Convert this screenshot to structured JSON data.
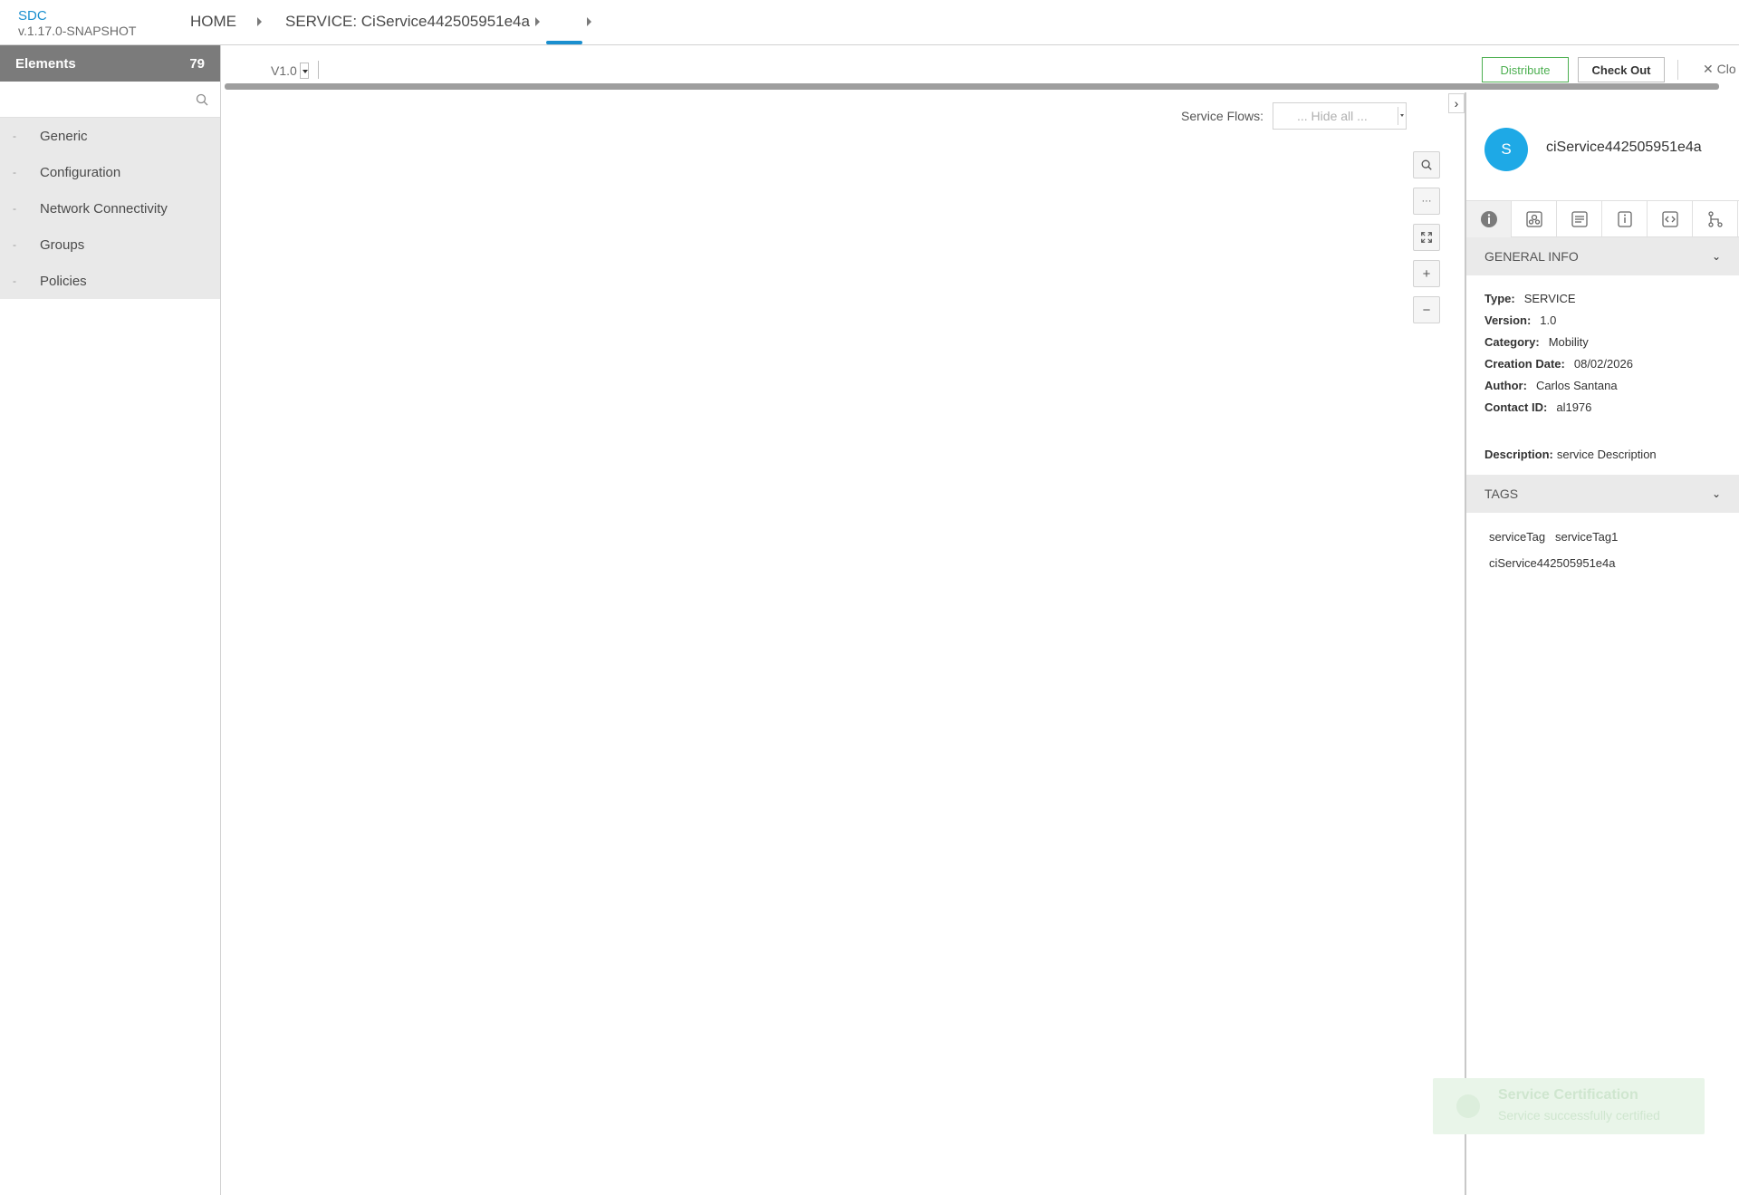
{
  "header": {
    "brand": "SDC",
    "version": "v.1.17.0-SNAPSHOT",
    "crumbs": [
      "HOME",
      "SERVICE: CiService442505951e4a",
      ""
    ]
  },
  "left_panel": {
    "title": "Elements",
    "count": "79",
    "search_placeholder": "",
    "items": [
      {
        "label": "Generic"
      },
      {
        "label": "Configuration"
      },
      {
        "label": "Network Connectivity"
      },
      {
        "label": "Groups"
      },
      {
        "label": "Policies"
      }
    ]
  },
  "toolbar": {
    "version": "V1.0",
    "distribute_label": "Distribute",
    "checkout_label": "Check Out",
    "close_label": "Clo"
  },
  "canvas": {
    "service_flows_label": "Service Flows:",
    "service_flows_value": "... Hide all ..."
  },
  "right_panel": {
    "avatar_letter": "S",
    "title": "ciService442505951e4a",
    "general_info_title": "GENERAL INFO",
    "fields": [
      {
        "label": "Type:",
        "value": "SERVICE"
      },
      {
        "label": "Version:",
        "value": "1.0"
      },
      {
        "label": "Category:",
        "value": "Mobility"
      },
      {
        "label": "Creation Date:",
        "value": "08/02/2026"
      },
      {
        "label": "Author:",
        "value": "Carlos Santana"
      },
      {
        "label": "Contact ID:",
        "value": "al1976"
      }
    ],
    "description_label": "Description:",
    "description_value": "service Description",
    "tags_title": "TAGS",
    "tags_line1": "serviceTag   serviceTag1",
    "tags_line2": "ciService442505951e4a"
  },
  "toast": {
    "title": "Service Certification",
    "message": "Service successfully certified"
  },
  "colors": {
    "accent": "#1a8fcf",
    "avatar": "#1ea9e6",
    "distribute": "#4caf50"
  }
}
